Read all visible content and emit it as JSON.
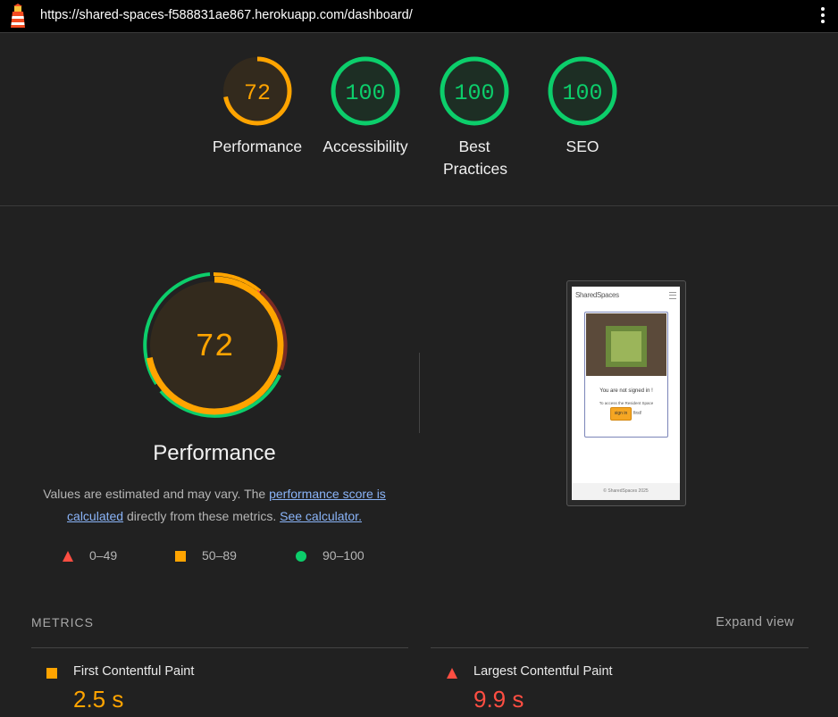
{
  "browser": {
    "url": "https://shared-spaces-f588831ae867.herokuapp.com/dashboard/"
  },
  "colors": {
    "pass": "#0cce6b",
    "average": "#ffa400",
    "fail": "#ff4e42",
    "background": "#212121"
  },
  "scores": [
    {
      "label": "Performance",
      "value": 72
    },
    {
      "label": "Accessibility",
      "value": 100
    },
    {
      "label": "Best Practices",
      "value": 100
    },
    {
      "label": "SEO",
      "value": 100
    }
  ],
  "performance": {
    "score": "72",
    "title": "Performance",
    "desc_pre": "Values are estimated and may vary. The ",
    "desc_link1": "performance score is calculated",
    "desc_mid": " directly from these metrics. ",
    "desc_link2": "See calculator."
  },
  "legend": [
    {
      "shape": "triangle",
      "range": "0–49"
    },
    {
      "shape": "square",
      "range": "50–89"
    },
    {
      "shape": "circle",
      "range": "90–100"
    }
  ],
  "screenshot": {
    "brand": "SharedSpaces",
    "not_signed": "You are not signed in !",
    "access_text": "To access the Resident Space",
    "signin": "sign in",
    "first": "first!",
    "footer": "© SharedSpaces 2025"
  },
  "metrics": {
    "heading": "METRICS",
    "expand": "Expand view",
    "items": [
      {
        "label": "First Contentful Paint",
        "value": "2.5 s",
        "rating": "average"
      },
      {
        "label": "Largest Contentful Paint",
        "value": "9.9 s",
        "rating": "fail"
      }
    ]
  }
}
